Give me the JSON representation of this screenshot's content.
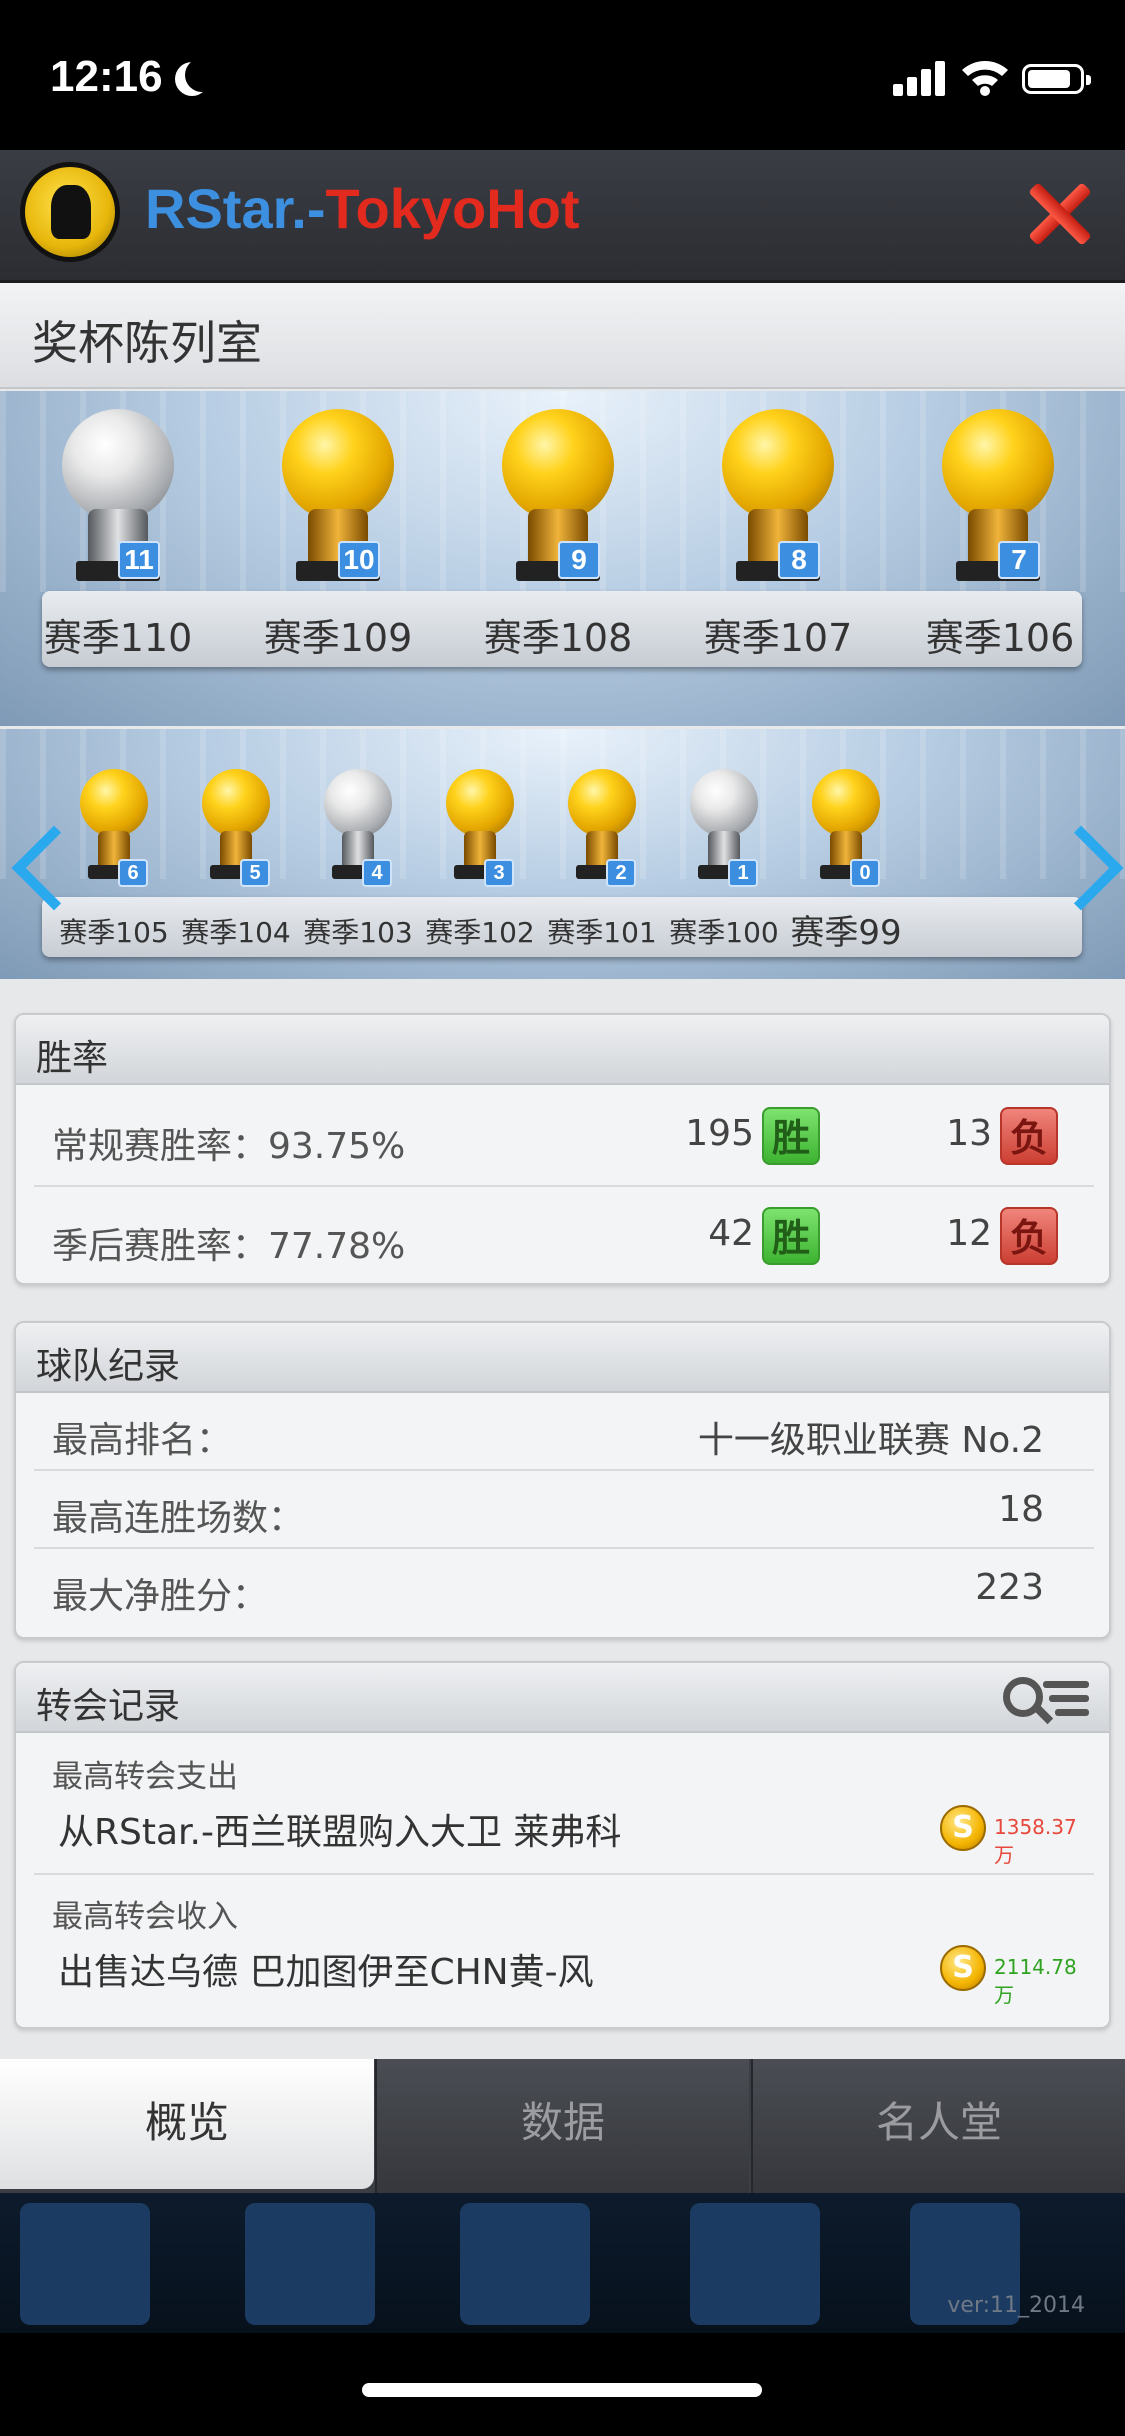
{
  "status_bar": {
    "time": "12:16"
  },
  "header": {
    "team_name_part1": "RStar.-",
    "team_name_part2": "TokyoHot"
  },
  "trophy_room": {
    "title": "奖杯陈列室",
    "row1": [
      {
        "season": "赛季110",
        "rank": "11",
        "type": "silver"
      },
      {
        "season": "赛季109",
        "rank": "10",
        "type": "gold"
      },
      {
        "season": "赛季108",
        "rank": "9",
        "type": "gold"
      },
      {
        "season": "赛季107",
        "rank": "8",
        "type": "gold"
      },
      {
        "season": "赛季106",
        "rank": "7",
        "type": "gold"
      }
    ],
    "row2": [
      {
        "season": "赛季105",
        "rank": "6",
        "type": "gold"
      },
      {
        "season": "赛季104",
        "rank": "5",
        "type": "gold"
      },
      {
        "season": "赛季103",
        "rank": "4",
        "type": "silver"
      },
      {
        "season": "赛季102",
        "rank": "3",
        "type": "gold"
      },
      {
        "season": "赛季101",
        "rank": "2",
        "type": "gold"
      },
      {
        "season": "赛季100",
        "rank": "1",
        "type": "silver"
      },
      {
        "season": "赛季99",
        "rank": "0",
        "type": "gold"
      }
    ]
  },
  "win_rate": {
    "title": "胜率",
    "win_label": "胜",
    "loss_label": "负",
    "rows": [
      {
        "label": "常规赛胜率：93.75%",
        "wins": "195",
        "losses": "13"
      },
      {
        "label": "季后赛胜率：77.78%",
        "wins": "42",
        "losses": "12"
      }
    ]
  },
  "team_record": {
    "title": "球队纪录",
    "rows": [
      {
        "label": "最高排名：",
        "value": "十一级职业联赛 No.2"
      },
      {
        "label": "最高连胜场数：",
        "value": "18"
      },
      {
        "label": "最大净胜分：",
        "value": "223"
      }
    ]
  },
  "transfer_record": {
    "title": "转会记录",
    "coin_symbol": "S",
    "expense": {
      "caption": "最高转会支出",
      "description": "从RStar.-西兰联盟购入大卫 莱弗科",
      "amount": "1358.37万"
    },
    "income": {
      "caption": "最高转会收入",
      "description": "出售达乌德 巴加图伊至CHN黄-风",
      "amount": "2114.78万"
    }
  },
  "tabs": [
    {
      "label": "概览",
      "active": true
    },
    {
      "label": "数据",
      "active": false
    },
    {
      "label": "名人堂",
      "active": false
    }
  ],
  "background": {
    "version": "ver:11_2014"
  },
  "colors": {
    "accent_blue": "#3d8fe0",
    "accent_red": "#e32a1f",
    "win_green": "#3db331",
    "loss_red": "#cc3f33"
  }
}
